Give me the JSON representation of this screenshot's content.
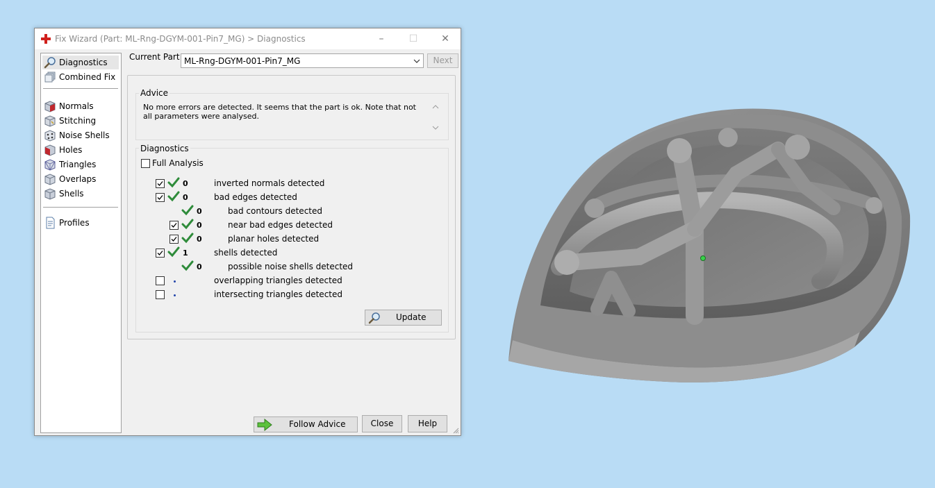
{
  "window": {
    "title": "Fix Wizard (Part: ML-Rng-DGYM-001-Pin7_MG) > Diagnostics",
    "minimize_glyph": "–",
    "maximize_glyph": "☐",
    "close_glyph": "✕"
  },
  "sidebar": {
    "items": [
      {
        "label": "Diagnostics",
        "icon": "magnifier-icon"
      },
      {
        "label": "Combined Fix",
        "icon": "combined-fix-icon"
      },
      {
        "label": "Normals",
        "icon": "normals-cube-icon"
      },
      {
        "label": "Stitching",
        "icon": "stitching-cube-icon"
      },
      {
        "label": "Noise Shells",
        "icon": "noise-shells-cube-icon"
      },
      {
        "label": "Holes",
        "icon": "holes-cube-icon"
      },
      {
        "label": "Triangles",
        "icon": "triangles-cube-icon"
      },
      {
        "label": "Overlaps",
        "icon": "overlaps-cube-icon"
      },
      {
        "label": "Shells",
        "icon": "shells-cube-icon"
      },
      {
        "label": "Profiles",
        "icon": "profiles-document-icon"
      }
    ]
  },
  "current_part": {
    "label": "Current Part:",
    "value": "ML-Rng-DGYM-001-Pin7_MG",
    "next_label": "Next"
  },
  "advice": {
    "title": "Advice",
    "text": "No more errors are detected. It seems that the part is ok. Note that not all parameters were analysed."
  },
  "diagnostics": {
    "title": "Diagnostics",
    "full_analysis_label": "Full Analysis",
    "rows": [
      {
        "checked": true,
        "status": "ok",
        "count": "0",
        "label": "inverted normals detected"
      },
      {
        "checked": true,
        "status": "ok",
        "count": "0",
        "label": "bad edges detected"
      },
      {
        "checked": null,
        "status": "ok",
        "count": "0",
        "label": "bad contours detected"
      },
      {
        "checked": true,
        "status": "ok",
        "count": "0",
        "label": "near bad edges detected"
      },
      {
        "checked": true,
        "status": "ok",
        "count": "0",
        "label": "planar holes detected"
      },
      {
        "checked": true,
        "status": "ok",
        "count": "1",
        "label": "shells detected"
      },
      {
        "checked": null,
        "status": "ok",
        "count": "0",
        "label": "possible noise shells detected"
      },
      {
        "checked": false,
        "status": "not-analysed",
        "count": "",
        "label": "overlapping triangles detected"
      },
      {
        "checked": false,
        "status": "not-analysed",
        "count": "",
        "label": "intersecting triangles detected"
      }
    ],
    "update_label": "Update"
  },
  "footer": {
    "follow_advice_label": "Follow Advice",
    "close_label": "Close",
    "help_label": "Help"
  },
  "colors": {
    "background": "#b9dcf5",
    "model_gray": "#8a8a8a",
    "check_green": "#2e8b3a"
  }
}
